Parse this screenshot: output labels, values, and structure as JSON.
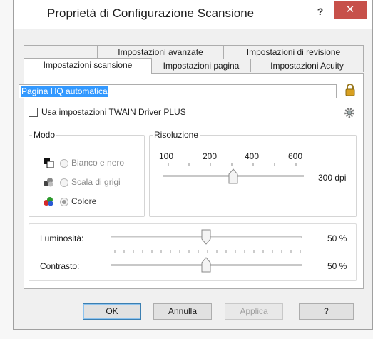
{
  "window": {
    "title": "Proprietà di Configurazione Scansione",
    "help_glyph": "?",
    "close_glyph": "✕"
  },
  "tabs": {
    "row_back": [
      "Impostazioni avanzate",
      "Impostazioni di revisione"
    ],
    "row_front": [
      "Impostazioni scansione",
      "Impostazioni pagina",
      "Impostazioni Acuity"
    ],
    "active": "Impostazioni scansione"
  },
  "profile": {
    "value": "Pagina HQ automatica"
  },
  "twain": {
    "label": "Usa impostazioni TWAIN Driver PLUS",
    "checked": false
  },
  "mode": {
    "title": "Modo",
    "options": [
      {
        "label": "Bianco e nero",
        "icon": "black-white-icon",
        "checked": false
      },
      {
        "label": "Scala di grigi",
        "icon": "grayscale-icon",
        "checked": false
      },
      {
        "label": "Colore",
        "icon": "color-icon",
        "checked": true
      }
    ]
  },
  "resolution": {
    "title": "Risoluzione",
    "ticks": [
      "100",
      "200",
      "400",
      "600"
    ],
    "value_text": "300 dpi",
    "value": 300
  },
  "adjust": {
    "brightness_label": "Luminosità:",
    "brightness_value": "50 %",
    "brightness": 50,
    "contrast_label": "Contrasto:",
    "contrast_value": "50 %",
    "contrast": 50
  },
  "buttons": {
    "ok": "OK",
    "cancel": "Annulla",
    "apply": "Applica",
    "help": "?"
  },
  "colors": {
    "close_red": "#c7504a",
    "selection_blue": "#3399ff",
    "lock_gold": "#d8a021"
  }
}
